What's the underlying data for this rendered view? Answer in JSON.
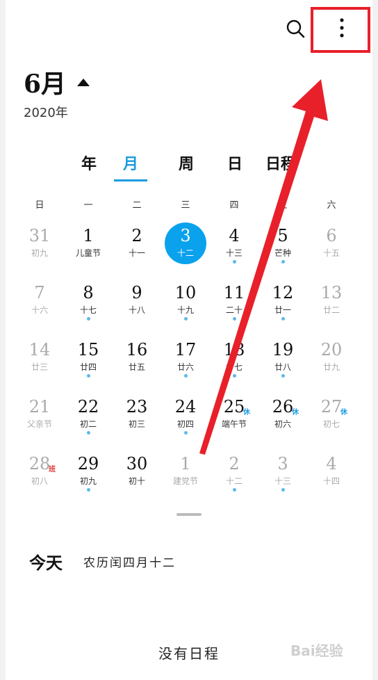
{
  "header": {
    "month": "6月",
    "year": "2020年",
    "search_icon": "search-icon",
    "more_icon": "more-vertical-icon"
  },
  "tabs": [
    {
      "label": "年",
      "active": false
    },
    {
      "label": "月",
      "active": true
    },
    {
      "label": "周",
      "active": false
    },
    {
      "label": "日",
      "active": false
    },
    {
      "label": "日程",
      "active": false
    }
  ],
  "weekdays": [
    "日",
    "一",
    "二",
    "三",
    "四",
    "五",
    "六"
  ],
  "weeks": [
    [
      {
        "day": "31",
        "lunar": "初九",
        "dim": true
      },
      {
        "day": "1",
        "lunar": "儿童节"
      },
      {
        "day": "2",
        "lunar": "十一"
      },
      {
        "day": "3",
        "lunar": "十二",
        "today": true
      },
      {
        "day": "4",
        "lunar": "十三",
        "dot": true
      },
      {
        "day": "5",
        "lunar": "芒种",
        "dot": true
      },
      {
        "day": "6",
        "lunar": "十五",
        "dim": true
      }
    ],
    [
      {
        "day": "7",
        "lunar": "十六",
        "dim": true
      },
      {
        "day": "8",
        "lunar": "十七",
        "dot": true
      },
      {
        "day": "9",
        "lunar": "十八"
      },
      {
        "day": "10",
        "lunar": "十九",
        "dot": true
      },
      {
        "day": "11",
        "lunar": "二十",
        "dot": true
      },
      {
        "day": "12",
        "lunar": "廿一",
        "dot": true
      },
      {
        "day": "13",
        "lunar": "廿二",
        "dim": true
      }
    ],
    [
      {
        "day": "14",
        "lunar": "廿三",
        "dim": true
      },
      {
        "day": "15",
        "lunar": "廿四",
        "dot": true
      },
      {
        "day": "16",
        "lunar": "廿五"
      },
      {
        "day": "17",
        "lunar": "廿六",
        "dot": true
      },
      {
        "day": "18",
        "lunar": "廿七",
        "dot": true
      },
      {
        "day": "19",
        "lunar": "廿八",
        "dot": true
      },
      {
        "day": "20",
        "lunar": "廿九",
        "dim": true
      }
    ],
    [
      {
        "day": "21",
        "lunar": "父亲节",
        "dim": true
      },
      {
        "day": "22",
        "lunar": "初二",
        "dot": true
      },
      {
        "day": "23",
        "lunar": "初三"
      },
      {
        "day": "24",
        "lunar": "初四",
        "dot": true
      },
      {
        "day": "25",
        "lunar": "端午节",
        "tag": "休"
      },
      {
        "day": "26",
        "lunar": "初六",
        "tag": "休"
      },
      {
        "day": "27",
        "lunar": "初七",
        "tag": "休",
        "dim": true
      }
    ],
    [
      {
        "day": "28",
        "lunar": "初八",
        "tag": "班",
        "tag_red": true,
        "dim": true
      },
      {
        "day": "29",
        "lunar": "初九",
        "dot": true
      },
      {
        "day": "30",
        "lunar": "初十"
      },
      {
        "day": "1",
        "lunar": "建党节",
        "dim": true
      },
      {
        "day": "2",
        "lunar": "十二",
        "dim": true,
        "dot": true
      },
      {
        "day": "3",
        "lunar": "十三",
        "dim": true,
        "dot": true
      },
      {
        "day": "4",
        "lunar": "十四",
        "dim": true
      }
    ]
  ],
  "today": {
    "label": "今天",
    "lunar_date": "农历闰四月十二"
  },
  "schedule": {
    "empty_text": "没有日程"
  },
  "watermark": "Bai经验",
  "colors": {
    "accent": "#1a9be0",
    "today_circle": "#0aa2ec",
    "highlight": "#e8202a",
    "dot": "#5bb9ec"
  }
}
